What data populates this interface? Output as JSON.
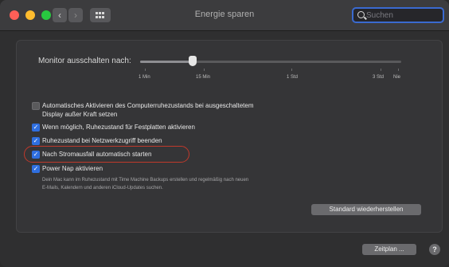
{
  "window": {
    "title": "Energie sparen"
  },
  "toolbar": {
    "back_glyph": "‹",
    "forward_glyph": "›",
    "grid_icon": "show-all-grid-icon",
    "search_placeholder": "Suchen",
    "search_value": ""
  },
  "monitor_slider": {
    "label": "Monitor ausschalten nach:",
    "value_fraction": 0.2,
    "ticks": [
      "1 Min",
      "15 Min",
      "1 Std",
      "3 Std",
      "Nie"
    ]
  },
  "options": [
    {
      "label": "Automatisches Aktivieren des Computerruhezustands bei ausgeschaltetem",
      "label2": "Display außer Kraft setzen",
      "checked": false
    },
    {
      "label": "Wenn möglich, Ruhezustand für Festplatten aktivieren",
      "checked": true
    },
    {
      "label": "Ruhezustand bei Netzwerkzugriff beenden",
      "checked": true
    },
    {
      "label": "Nach Stromausfall automatisch starten",
      "checked": true
    },
    {
      "label": "Power Nap aktivieren",
      "checked": true
    }
  ],
  "power_nap_description": {
    "line1": "Dein Mac kann im Ruhezustand mit Time Machine Backups erstellen und regelmäßig nach neuen",
    "line2": "E-Mails, Kalendern und anderen iCloud-Updates suchen."
  },
  "buttons": {
    "restore_defaults": "Standard wiederherstellen",
    "schedule": "Zeitplan ...",
    "help": "?"
  },
  "checkmark_glyph": "✓",
  "colors": {
    "accent": "#2f6fe0",
    "highlight_ring": "#c0392b",
    "search_focus": "#3a6ad0"
  }
}
